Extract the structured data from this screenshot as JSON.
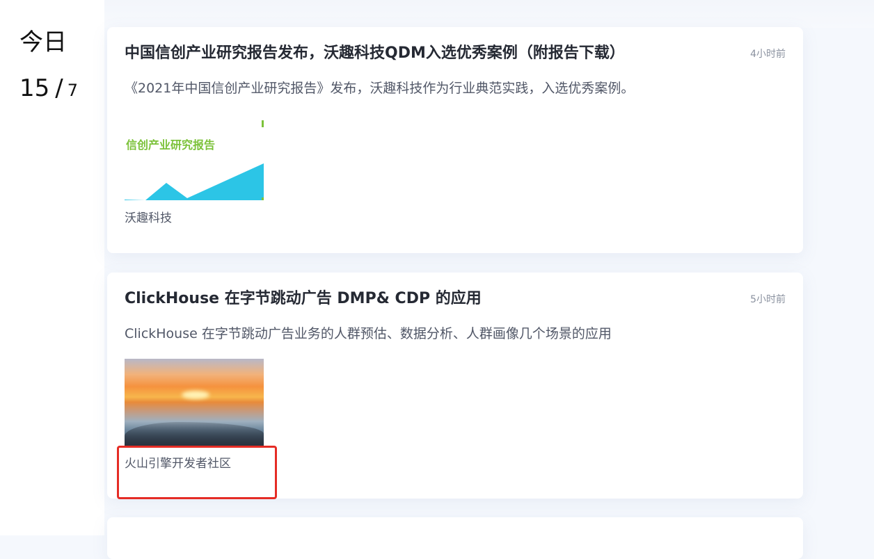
{
  "date": {
    "today_label": "今日",
    "day": "15",
    "separator": "/",
    "month": "7"
  },
  "articles": [
    {
      "title": "中国信创产业研究报告发布，沃趣科技QDM入选优秀案例（附报告下载）",
      "time": "4小时前",
      "description": "《2021年中国信创产业研究报告》发布，沃趣科技作为行业典范实践，入选优秀案例。",
      "thumbnail_text": "信创产业研究报告",
      "source": "沃趣科技"
    },
    {
      "title": "ClickHouse 在字节跳动广告 DMP& CDP 的应用",
      "time": "5小时前",
      "description": "ClickHouse 在字节跳动广告业务的人群预估、数据分析、人群画像几个场景的应用",
      "source": "火山引擎开发者社区"
    }
  ],
  "colors": {
    "highlight": "#e52c25",
    "report_green": "#7cc23a",
    "report_blue": "#2cc5e6"
  }
}
